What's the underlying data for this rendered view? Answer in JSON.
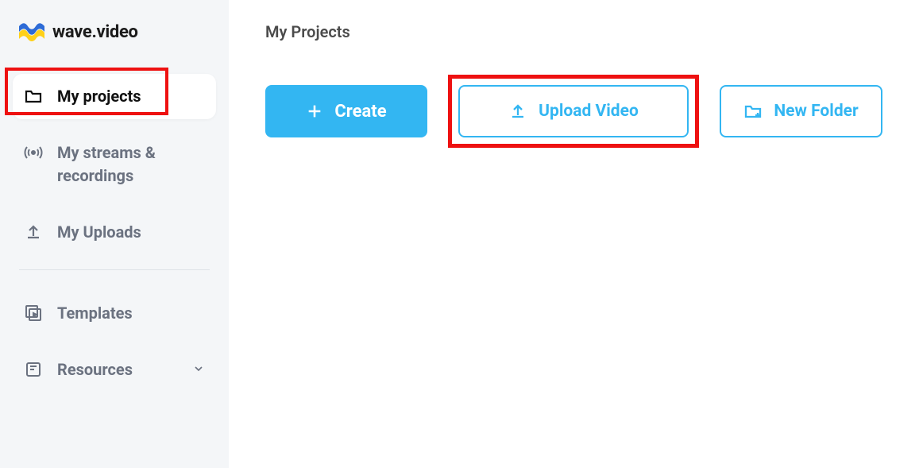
{
  "brand": {
    "name": "wave.video"
  },
  "sidebar": {
    "items": [
      {
        "label": "My projects"
      },
      {
        "label": "My streams & recordings"
      },
      {
        "label": "My Uploads"
      },
      {
        "label": "Templates"
      },
      {
        "label": "Resources"
      }
    ]
  },
  "main": {
    "title": "My Projects",
    "buttons": {
      "create": "Create",
      "upload": "Upload Video",
      "newfolder": "New Folder"
    }
  }
}
